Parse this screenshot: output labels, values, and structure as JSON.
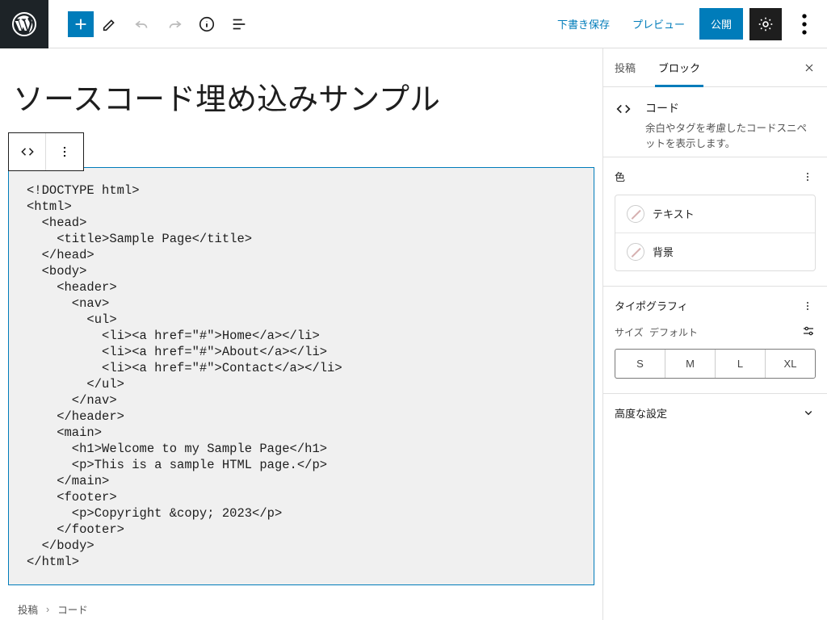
{
  "toolbar": {
    "save_draft": "下書き保存",
    "preview": "プレビュー",
    "publish": "公開"
  },
  "post": {
    "title": "ソースコード埋め込みサンプル",
    "code_content": "<!DOCTYPE html>\n<html>\n  <head>\n    <title>Sample Page</title>\n  </head>\n  <body>\n    <header>\n      <nav>\n        <ul>\n          <li><a href=\"#\">Home</a></li>\n          <li><a href=\"#\">About</a></li>\n          <li><a href=\"#\">Contact</a></li>\n        </ul>\n      </nav>\n    </header>\n    <main>\n      <h1>Welcome to my Sample Page</h1>\n      <p>This is a sample HTML page.</p>\n    </main>\n    <footer>\n      <p>Copyright &copy; 2023</p>\n    </footer>\n  </body>\n</html>"
  },
  "breadcrumb": {
    "root": "投稿",
    "current": "コード"
  },
  "sidebar": {
    "tabs": {
      "post": "投稿",
      "block": "ブロック"
    },
    "block": {
      "name": "コード",
      "description": "余白やタグを考慮したコードスニペットを表示します。"
    },
    "color": {
      "title": "色",
      "text_label": "テキスト",
      "bg_label": "背景"
    },
    "typography": {
      "title": "タイポグラフィ",
      "size_label": "サイズ",
      "size_default": "デフォルト",
      "sizes": [
        "S",
        "M",
        "L",
        "XL"
      ]
    },
    "advanced": {
      "title": "高度な設定"
    }
  }
}
